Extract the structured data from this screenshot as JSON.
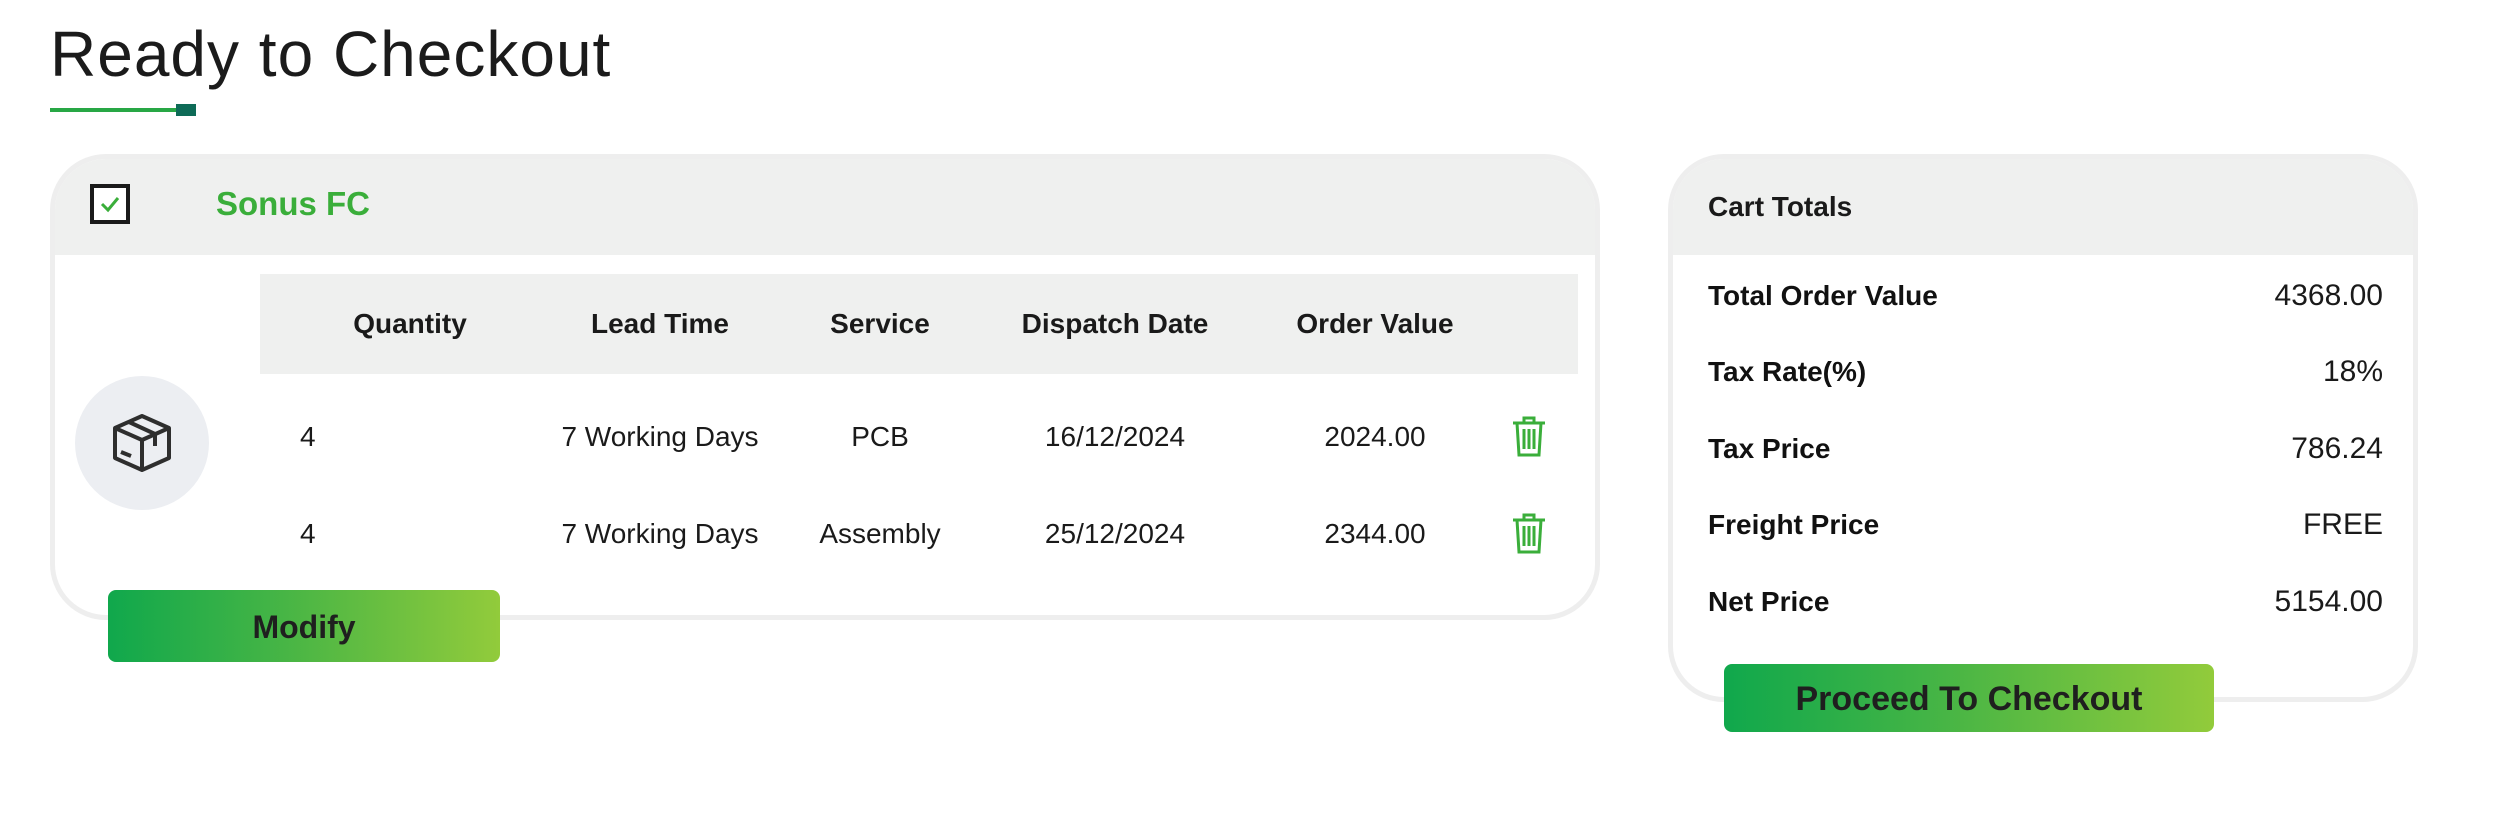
{
  "page": {
    "title": "Ready to Checkout"
  },
  "order": {
    "vendor": "Sonus FC",
    "checked": true,
    "columns": [
      "Quantity",
      "Lead Time",
      "Service",
      "Dispatch Date",
      "Order Value"
    ],
    "rows": [
      {
        "quantity": "4",
        "lead_time": "7 Working Days",
        "service": "PCB",
        "dispatch_date": "16/12/2024",
        "order_value": "2024.00"
      },
      {
        "quantity": "4",
        "lead_time": "7 Working Days",
        "service": "Assembly",
        "dispatch_date": "25/12/2024",
        "order_value": "2344.00"
      }
    ],
    "modify_label": "Modify"
  },
  "totals": {
    "title": "Cart Totals",
    "items": [
      {
        "label": "Total Order Value",
        "value": "4368.00"
      },
      {
        "label": "Tax Rate(%)",
        "value": "18%"
      },
      {
        "label": "Tax Price",
        "value": "786.24"
      },
      {
        "label": "Freight Price",
        "value": "FREE"
      },
      {
        "label": "Net Price",
        "value": "5154.00"
      }
    ],
    "checkout_label": "Proceed To Checkout"
  },
  "colors": {
    "accent_green": "#3aae3a",
    "gradient_start": "#10a84c",
    "gradient_end": "#92cb3b",
    "header_gray": "#eff0ef"
  },
  "icons": {
    "checkbox": "check-icon",
    "package": "package-icon",
    "delete": "trash-icon"
  }
}
